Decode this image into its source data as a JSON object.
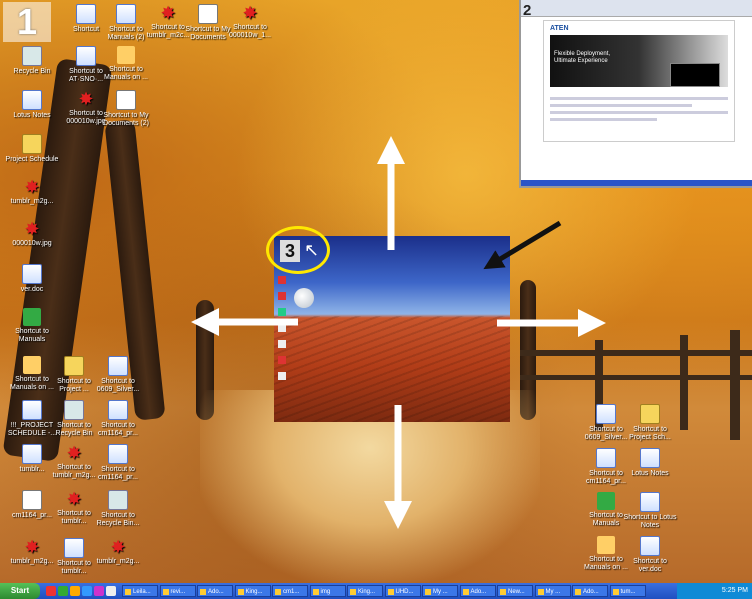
{
  "labels": {
    "one": "1",
    "two": "2",
    "three": "3"
  },
  "colors": {
    "highlight": "#ffe800",
    "taskbar": "#245edb",
    "start": "#3aa33d"
  },
  "desktop_icons_left": [
    {
      "label": "Shortcut",
      "glyph": "g-doc"
    },
    {
      "label": "Shortcut to Manuals (2)",
      "glyph": "g-doc"
    },
    {
      "label": "Shortcut to tumblr_m2c...",
      "glyph": "g-star"
    },
    {
      "label": "Shortcut to My Documents",
      "glyph": "g-img"
    },
    {
      "label": "Shortcut to 000010w_1...",
      "glyph": "g-star"
    },
    {
      "label": "Recycle Bin",
      "glyph": "g-bin"
    },
    {
      "label": "Shortcut to AT·SNO·...",
      "glyph": "g-doc"
    },
    {
      "label": "Shortcut to Manuals on ...",
      "glyph": "g-people"
    },
    {
      "label": "Lotus Notes",
      "glyph": "g-doc"
    },
    {
      "label": "Shortcut to 000010w.jpg",
      "glyph": "g-star"
    },
    {
      "label": "Shortcut to My Documents (2)",
      "glyph": "g-img"
    },
    {
      "label": "Project Schedule",
      "glyph": "g-folder"
    },
    {
      "label": "tumblr_m2g...",
      "glyph": "g-star"
    },
    {
      "label": "000010w.jpg",
      "glyph": "g-star"
    },
    {
      "label": "ver.doc",
      "glyph": "g-doc"
    },
    {
      "label": "Shortcut to Manuals",
      "glyph": "g-green"
    },
    {
      "label": "Shortcut to Manuals on ...",
      "glyph": "g-people"
    },
    {
      "label": "Shortcut to Project ...",
      "glyph": "g-folder"
    },
    {
      "label": "Shortcut to 0609_Silver...",
      "glyph": "g-doc"
    },
    {
      "label": "!!!_PROJECT SCHEDULE -...",
      "glyph": "g-doc"
    },
    {
      "label": "Shortcut to Recycle Bin",
      "glyph": "g-bin"
    },
    {
      "label": "Shortcut to cm1164_pr...",
      "glyph": "g-doc"
    },
    {
      "label": "tumblr...",
      "glyph": "g-doc"
    },
    {
      "label": "Shortcut to tumblr_m2g...",
      "glyph": "g-star"
    },
    {
      "label": "Shortcut to cm1164_pr...",
      "glyph": "g-doc"
    },
    {
      "label": "cm1164_pr...",
      "glyph": "g-img"
    },
    {
      "label": "Shortcut to tumblr...",
      "glyph": "g-star"
    },
    {
      "label": "Shortcut to Recycle Bin...",
      "glyph": "g-bin"
    },
    {
      "label": "tumblr_m2g...",
      "glyph": "g-star"
    },
    {
      "label": "Shortcut to tumblr...",
      "glyph": "g-doc"
    },
    {
      "label": "tumblr_m2g...",
      "glyph": "g-star"
    }
  ],
  "desktop_icons_right": [
    {
      "label": "Shortcut to 0609_Silver...",
      "glyph": "g-doc"
    },
    {
      "label": "Shortcut to Project Sch...",
      "glyph": "g-folder"
    },
    {
      "label": "Shortcut to cm1164_pr...",
      "glyph": "g-doc"
    },
    {
      "label": "Lotus Notes",
      "glyph": "g-doc"
    },
    {
      "label": "Shortcut to Manuals",
      "glyph": "g-green"
    },
    {
      "label": "Shortcut to Lotus Notes",
      "glyph": "g-doc"
    },
    {
      "label": "Shortcut to Manuals on ...",
      "glyph": "g-people"
    },
    {
      "label": "Shortcut to ver.doc",
      "glyph": "g-doc"
    }
  ],
  "panel2": {
    "logo": "ATEN",
    "hero_text": "Flexible Deployment, Ultimate Experience"
  },
  "taskbar": {
    "start": "Start",
    "items": [
      "Leila...",
      "revi...",
      "Ado...",
      "King...",
      "cm1...",
      "img",
      "King...",
      "UHD...",
      "My ...",
      "Ado...",
      "New...",
      "My ...",
      "Ado...",
      "tum..."
    ],
    "clock": "5:25 PM"
  }
}
